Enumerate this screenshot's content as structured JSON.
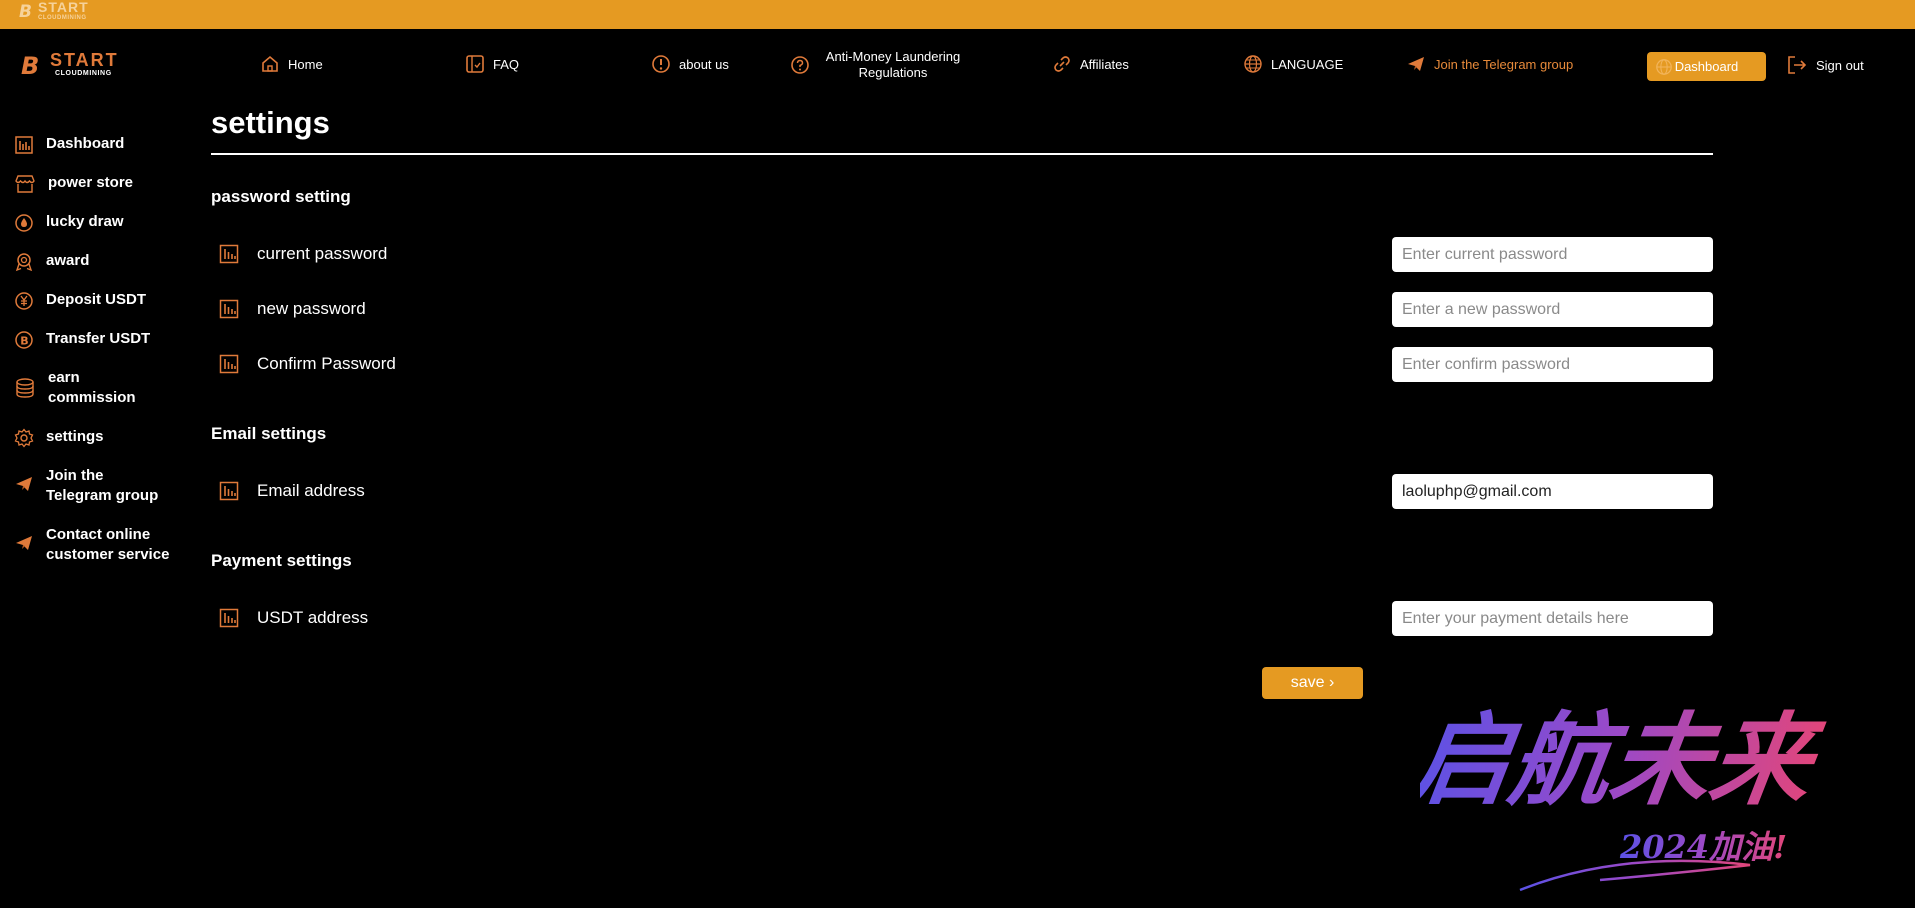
{
  "brand": {
    "name": "START",
    "subtitle": "CLOUDMINING"
  },
  "nav": {
    "home": "Home",
    "faq": "FAQ",
    "about": "about us",
    "aml": "Anti-Money Laundering Regulations",
    "affiliates": "Affiliates",
    "language": "LANGUAGE",
    "telegram": "Join the Telegram group",
    "dashboard": "Dashboard",
    "signout": "Sign out"
  },
  "sidebar": {
    "items": [
      {
        "label": "Dashboard",
        "icon": "bar-chart-icon"
      },
      {
        "label": "power store",
        "icon": "store-icon"
      },
      {
        "label": "lucky draw",
        "icon": "drop-icon"
      },
      {
        "label": "award",
        "icon": "award-icon"
      },
      {
        "label": "Deposit USDT",
        "icon": "yen-icon"
      },
      {
        "label": "Transfer USDT",
        "icon": "bitcoin-icon"
      },
      {
        "label": "earn commission",
        "icon": "coins-icon"
      },
      {
        "label": "settings",
        "icon": "gear-icon"
      },
      {
        "label": "Join the Telegram group",
        "icon": "telegram-icon"
      },
      {
        "label": "Contact online customer service",
        "icon": "telegram-icon"
      }
    ]
  },
  "main": {
    "title": "settings",
    "password_section": "password setting",
    "current_password": {
      "label": "current password",
      "placeholder": "Enter current password"
    },
    "new_password": {
      "label": "new password",
      "placeholder": "Enter a new password"
    },
    "confirm_password": {
      "label": "Confirm Password",
      "placeholder": "Enter confirm password"
    },
    "email_section": "Email settings",
    "email": {
      "label": "Email address",
      "value": "laoluphp@gmail.com"
    },
    "payment_section": "Payment settings",
    "usdt": {
      "label": "USDT address",
      "placeholder": "Enter your payment details here"
    },
    "save": "save ›"
  },
  "watermark": {
    "main": "启航未来",
    "sub": "2024加油!"
  },
  "colors": {
    "accent": "#e59a22",
    "icon_orange": "#e07a3a",
    "background": "#000000"
  }
}
